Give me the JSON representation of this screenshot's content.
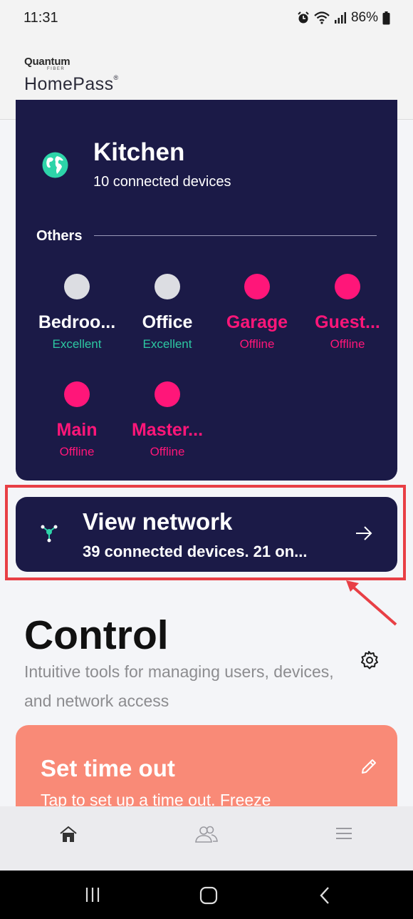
{
  "status_bar": {
    "time": "11:31",
    "battery": "86%"
  },
  "header": {
    "brand_small": "Quantum",
    "brand_fiber": "FIBER",
    "app_name": "HomePass"
  },
  "network": {
    "location_title": "Kitchen",
    "location_devices": "10 connected devices",
    "others_label": "Others",
    "pods": [
      {
        "name": "Bedroo...",
        "status": "Excellent"
      },
      {
        "name": "Office",
        "status": "Excellent"
      },
      {
        "name": "Garage",
        "status": "Offline"
      },
      {
        "name": "Guest...",
        "status": "Offline"
      },
      {
        "name": "Main",
        "status": "Offline"
      },
      {
        "name": "Master...",
        "status": "Offline"
      }
    ]
  },
  "view_network": {
    "title": "View network",
    "subtitle": "39 connected devices. 21 on..."
  },
  "control": {
    "title": "Control",
    "description": "Intuitive tools for managing users, devices, and network access"
  },
  "timeout": {
    "title": "Set time out",
    "description": "Tap to set up a time out. Freeze"
  },
  "colors": {
    "card_bg": "#1b1a47",
    "offline": "#ff1679",
    "excellent": "#2dc8a2",
    "timeout_bg": "#f98a77",
    "highlight": "#e83f45"
  }
}
